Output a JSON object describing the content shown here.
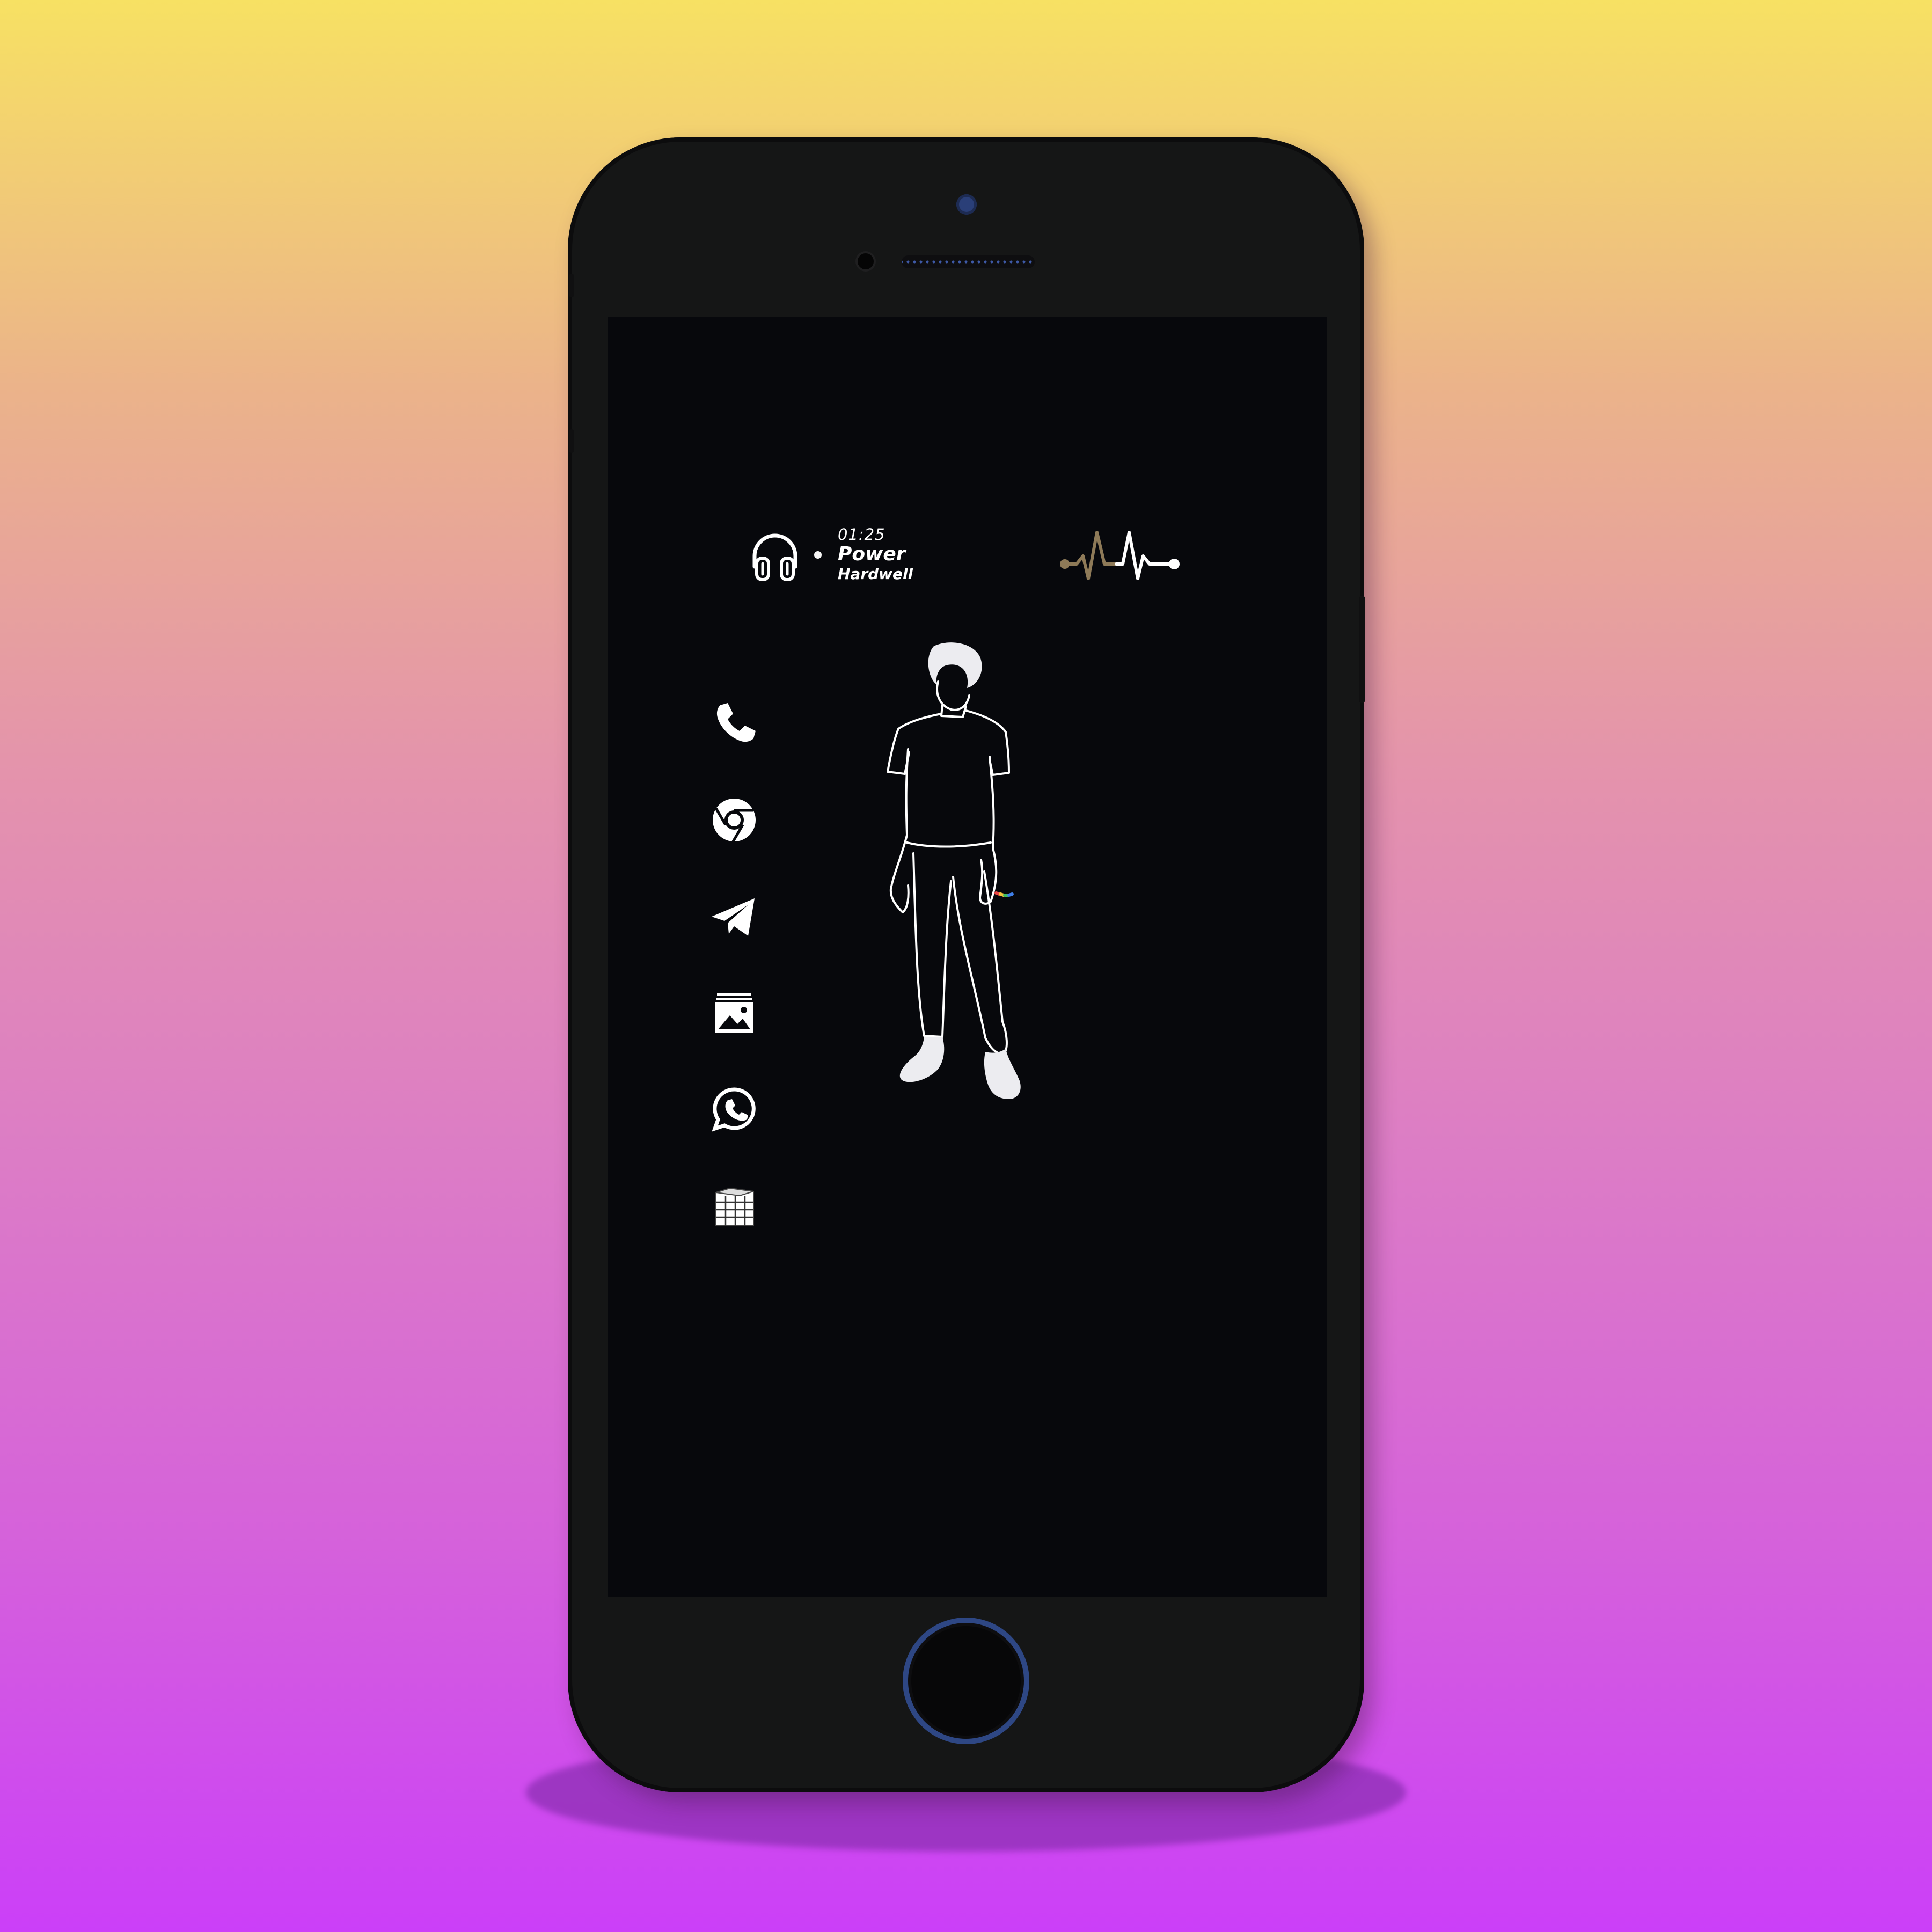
{
  "background": {
    "gradient_colors": [
      "#f7e163",
      "#e493ac",
      "#cb3ff8"
    ]
  },
  "device": {
    "body_color": "#151616",
    "screen_color": "#07080c",
    "accent_color": "#2e4784"
  },
  "music_widget": {
    "icon": "headphones-icon",
    "time": "01:25",
    "title": "Power",
    "artist": "Hardwell"
  },
  "pulse_widget": {
    "icon": "heartbeat-icon",
    "colors": [
      "#8e7a58",
      "#ffffff"
    ]
  },
  "dock": {
    "apps": [
      {
        "name": "Phone",
        "icon": "phone-icon"
      },
      {
        "name": "Chrome",
        "icon": "chrome-icon"
      },
      {
        "name": "Telegram",
        "icon": "telegram-icon"
      },
      {
        "name": "Gallery",
        "icon": "gallery-icon"
      },
      {
        "name": "WhatsApp",
        "icon": "whatsapp-icon"
      },
      {
        "name": "Apps",
        "icon": "cube-grid-icon"
      }
    ]
  },
  "wallpaper": {
    "subject": "standing-figure-line-art",
    "line_color": "#ffffff"
  }
}
